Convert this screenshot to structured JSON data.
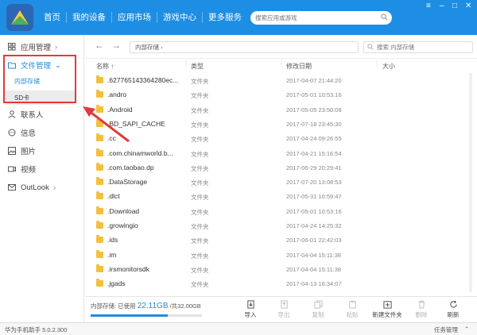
{
  "app": {
    "version_text": "华为手机助手 5.0.2.300",
    "task_manager": "任务管理"
  },
  "topnav": [
    {
      "label": "首页"
    },
    {
      "label": "我的设备"
    },
    {
      "label": "应用市场"
    },
    {
      "label": "游戏中心"
    },
    {
      "label": "更多服务"
    }
  ],
  "top_search": {
    "placeholder": "搜索应用或游戏"
  },
  "window_controls": [
    "menu",
    "minimize",
    "maximize",
    "close"
  ],
  "sidebar": {
    "items": [
      {
        "label": "应用管理",
        "icon": "grid-icon",
        "chevron": ">"
      },
      {
        "label": "文件管理",
        "icon": "folder-icon",
        "chevron": "v",
        "active": true
      },
      {
        "label": "联系人",
        "icon": "person-icon"
      },
      {
        "label": "信息",
        "icon": "message-icon"
      },
      {
        "label": "图片",
        "icon": "image-icon"
      },
      {
        "label": "视频",
        "icon": "video-icon"
      },
      {
        "label": "OutLook",
        "icon": "mail-icon",
        "chevron": ">"
      }
    ],
    "sub_items": [
      {
        "label": "内部存储",
        "selected": true
      },
      {
        "label": "SD卡",
        "selected": false
      }
    ]
  },
  "toolbar": {
    "breadcrumb": "内部存储 ›",
    "search_placeholder": "搜索 内部存储"
  },
  "columns": {
    "name": "名称 ↑",
    "type": "类型",
    "date": "修改日期",
    "size": "大小"
  },
  "files": [
    {
      "name": ".627765143364280ec...",
      "type": "文件夹",
      "date": "2017-04-07 21:44:20"
    },
    {
      "name": ".andro",
      "type": "文件夹",
      "date": "2017-05-01 10:53:16"
    },
    {
      "name": ".Android",
      "type": "文件夹",
      "date": "2017-05-05 23:50:08"
    },
    {
      "name": ".BD_SAPI_CACHE",
      "type": "文件夹",
      "date": "2017-07-18 23:45:30"
    },
    {
      "name": ".cc",
      "type": "文件夹",
      "date": "2017-04-24 09:26:55"
    },
    {
      "name": ".com.chinamworld.b...",
      "type": "文件夹",
      "date": "2017-04-21 15:16:54"
    },
    {
      "name": ".com.taobao.dp",
      "type": "文件夹",
      "date": "2017-06-29 20:29:41"
    },
    {
      "name": ".DataStorage",
      "type": "文件夹",
      "date": "2017-07-20 13:08:53"
    },
    {
      "name": ".dlct",
      "type": "文件夹",
      "date": "2017-05-31 10:59:47"
    },
    {
      "name": ".Download",
      "type": "文件夹",
      "date": "2017-05-01 10:53:16"
    },
    {
      "name": ".growingio",
      "type": "文件夹",
      "date": "2017-04-24 14:25:32"
    },
    {
      "name": ".ids",
      "type": "文件夹",
      "date": "2017-06-01 22:42:03"
    },
    {
      "name": ".im",
      "type": "文件夹",
      "date": "2017-04-04 15:11:38"
    },
    {
      "name": ".irsmonitorsdk",
      "type": "文件夹",
      "date": "2017-04-04 15:11:38"
    },
    {
      "name": ".jgads",
      "type": "文件夹",
      "date": "2017-04-13 16:34:07"
    }
  ],
  "storage": {
    "label": "内部存储: 已使用 ",
    "used": "22.11GB",
    "total": " /共32.00GB",
    "used_fraction": 0.69
  },
  "actions": [
    {
      "label": "导入",
      "icon": "import-icon",
      "enabled": true
    },
    {
      "label": "导出",
      "icon": "export-icon",
      "enabled": false
    },
    {
      "label": "复制",
      "icon": "copy-icon",
      "enabled": false
    },
    {
      "label": "粘贴",
      "icon": "paste-icon",
      "enabled": false
    },
    {
      "label": "新建文件夹",
      "icon": "new-folder-icon",
      "enabled": true
    },
    {
      "label": "删除",
      "icon": "delete-icon",
      "enabled": false
    },
    {
      "label": "刷新",
      "icon": "refresh-icon",
      "enabled": true
    }
  ],
  "colors": {
    "brand": "#1e8ee4",
    "highlight": "#e03b3b",
    "folder": "#f3c03d"
  }
}
